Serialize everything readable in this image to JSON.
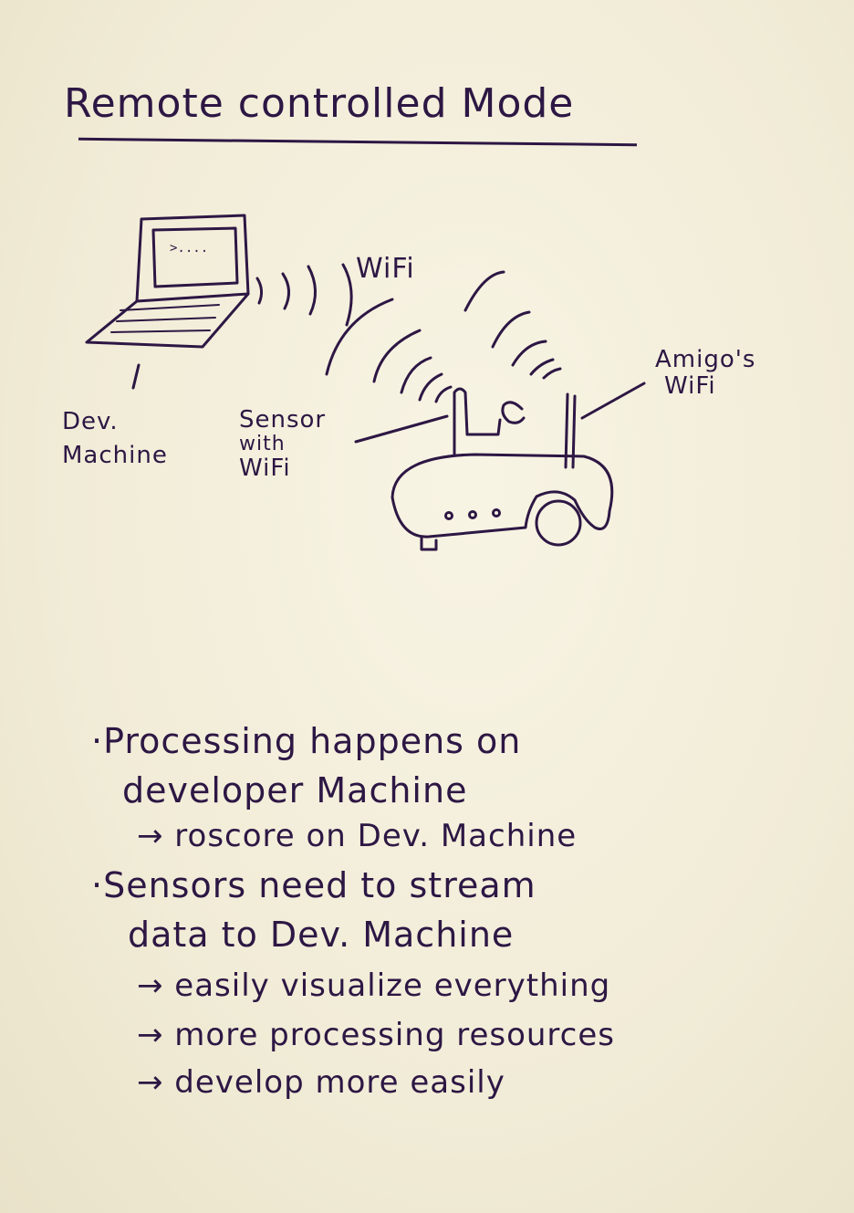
{
  "title": "Remote controlled Mode",
  "labels": {
    "wifi": "WiFi",
    "dev_machine": [
      "Dev.",
      "Machine"
    ],
    "sensor": [
      "Sensor",
      "with",
      "WiFi"
    ],
    "amigo_wifi": [
      "Amigo's",
      "WiFi"
    ]
  },
  "terminal_prompt": ">....",
  "notes": {
    "bullet1": [
      "Processing happens on",
      "developer Machine"
    ],
    "bullet1_sub": "→ roscore on Dev. Machine",
    "bullet2": [
      "Sensors need to stream",
      "data to Dev. Machine"
    ],
    "bullet2_subs": [
      "→ easily visualize everything",
      "→ more processing resources",
      "→ develop more easily"
    ]
  },
  "ink_color": "#2d1744"
}
